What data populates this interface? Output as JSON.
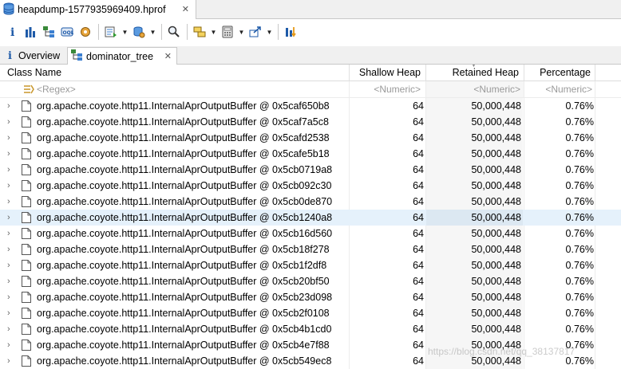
{
  "editor_tab": {
    "title": "heapdump-1577935969409.hprof",
    "close": "✕"
  },
  "toolbar": {
    "icons": [
      "info-icon",
      "histogram-icon",
      "dominator-tree-icon",
      "oql-icon",
      "thread-overview-icon",
      "run-report-icon",
      "query-browser-icon",
      "search-icon",
      "group-by-icon",
      "calculate-retained-icon",
      "export-icon",
      "compare-icon"
    ]
  },
  "view_tabs": [
    {
      "label": "Overview",
      "close": ""
    },
    {
      "label": "dominator_tree",
      "close": "✕"
    }
  ],
  "columns": {
    "class_name": "Class Name",
    "shallow_heap": "Shallow Heap",
    "retained_heap": "Retained Heap",
    "percentage": "Percentage"
  },
  "filter": {
    "regex": "<Regex>",
    "numeric_shallow": "<Numeric>",
    "numeric_retained": "<Numeric>",
    "numeric_pct": "<Numeric>"
  },
  "rows": [
    {
      "name": "org.apache.coyote.http11.InternalAprOutputBuffer @ 0x5caf650b8",
      "shallow": "64",
      "retained": "50,000,448",
      "pct": "0.76%"
    },
    {
      "name": "org.apache.coyote.http11.InternalAprOutputBuffer @ 0x5caf7a5c8",
      "shallow": "64",
      "retained": "50,000,448",
      "pct": "0.76%"
    },
    {
      "name": "org.apache.coyote.http11.InternalAprOutputBuffer @ 0x5cafd2538",
      "shallow": "64",
      "retained": "50,000,448",
      "pct": "0.76%"
    },
    {
      "name": "org.apache.coyote.http11.InternalAprOutputBuffer @ 0x5cafe5b18",
      "shallow": "64",
      "retained": "50,000,448",
      "pct": "0.76%"
    },
    {
      "name": "org.apache.coyote.http11.InternalAprOutputBuffer @ 0x5cb0719a8",
      "shallow": "64",
      "retained": "50,000,448",
      "pct": "0.76%"
    },
    {
      "name": "org.apache.coyote.http11.InternalAprOutputBuffer @ 0x5cb092c30",
      "shallow": "64",
      "retained": "50,000,448",
      "pct": "0.76%"
    },
    {
      "name": "org.apache.coyote.http11.InternalAprOutputBuffer @ 0x5cb0de870",
      "shallow": "64",
      "retained": "50,000,448",
      "pct": "0.76%"
    },
    {
      "name": "org.apache.coyote.http11.InternalAprOutputBuffer @ 0x5cb1240a8",
      "shallow": "64",
      "retained": "50,000,448",
      "pct": "0.76%"
    },
    {
      "name": "org.apache.coyote.http11.InternalAprOutputBuffer @ 0x5cb16d560",
      "shallow": "64",
      "retained": "50,000,448",
      "pct": "0.76%"
    },
    {
      "name": "org.apache.coyote.http11.InternalAprOutputBuffer @ 0x5cb18f278",
      "shallow": "64",
      "retained": "50,000,448",
      "pct": "0.76%"
    },
    {
      "name": "org.apache.coyote.http11.InternalAprOutputBuffer @ 0x5cb1f2df8",
      "shallow": "64",
      "retained": "50,000,448",
      "pct": "0.76%"
    },
    {
      "name": "org.apache.coyote.http11.InternalAprOutputBuffer @ 0x5cb20bf50",
      "shallow": "64",
      "retained": "50,000,448",
      "pct": "0.76%"
    },
    {
      "name": "org.apache.coyote.http11.InternalAprOutputBuffer @ 0x5cb23d098",
      "shallow": "64",
      "retained": "50,000,448",
      "pct": "0.76%"
    },
    {
      "name": "org.apache.coyote.http11.InternalAprOutputBuffer @ 0x5cb2f0108",
      "shallow": "64",
      "retained": "50,000,448",
      "pct": "0.76%"
    },
    {
      "name": "org.apache.coyote.http11.InternalAprOutputBuffer @ 0x5cb4b1cd0",
      "shallow": "64",
      "retained": "50,000,448",
      "pct": "0.76%"
    },
    {
      "name": "org.apache.coyote.http11.InternalAprOutputBuffer @ 0x5cb4e7f88",
      "shallow": "64",
      "retained": "50,000,448",
      "pct": "0.76%"
    },
    {
      "name": "org.apache.coyote.http11.InternalAprOutputBuffer @ 0x5cb549ec8",
      "shallow": "64",
      "retained": "50,000,448",
      "pct": "0.76%"
    }
  ],
  "selected_row": 7,
  "watermark": "https://blog.csdn.net/qq_38137817",
  "colors": {
    "selection": "#e5f1fb",
    "accent": "#1e5aa8"
  }
}
